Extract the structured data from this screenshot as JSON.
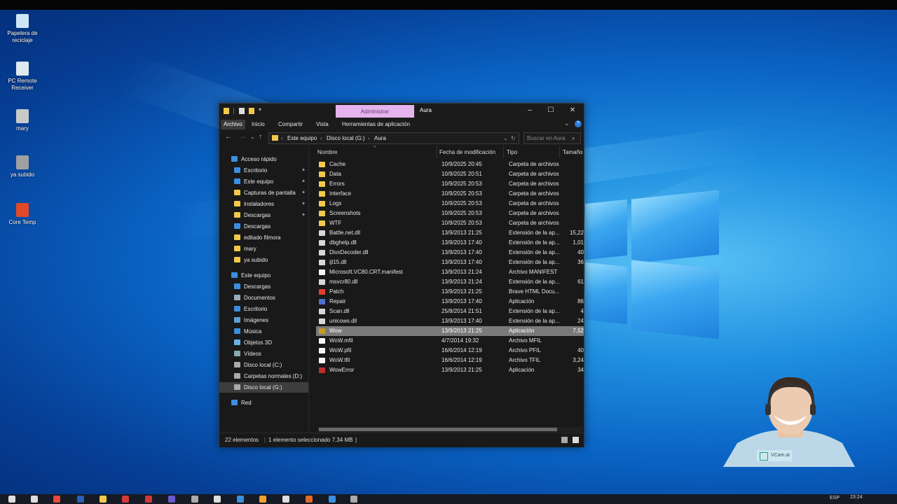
{
  "desktop": {
    "icons": [
      {
        "label": "Papelera de reciclaje",
        "color": "#cfe6f7"
      },
      {
        "label": "PC Remote Receiver",
        "color": "#dfe9f0"
      },
      {
        "label": "mary",
        "color": "#c9c9c9"
      },
      {
        "label": "ya subido",
        "color": "#a0a0a0"
      },
      {
        "label": "Core Temp",
        "color": "#e04a2a"
      }
    ]
  },
  "window": {
    "admin_tab": "Administrar",
    "title": "Aura",
    "minimize": "–",
    "maximize": "☐",
    "close": "✕",
    "help": "?",
    "ribbon_tabs": [
      "Archivo",
      "Inicio",
      "Compartir",
      "Vista",
      "Herramientas de aplicación"
    ],
    "breadcrumb": [
      "Este equipo",
      "Disco local (G:)",
      "Aura"
    ],
    "search_placeholder": "Buscar en Aura"
  },
  "navpane": {
    "quick_access": "Acceso rápido",
    "items": [
      {
        "label": "Acceso rápido",
        "icon": "star-icon",
        "color": "#3b8fe0",
        "pinned": false,
        "indent": 0
      },
      {
        "label": "Escritorio",
        "icon": "desktop-icon",
        "color": "#3b8fe0",
        "pinned": true,
        "indent": 1
      },
      {
        "label": "Este equipo",
        "icon": "computer-icon",
        "color": "#3b8fe0",
        "pinned": true,
        "indent": 1
      },
      {
        "label": "Capturas de pantalla",
        "icon": "folder-icon",
        "color": "#f2c94c",
        "pinned": true,
        "indent": 1
      },
      {
        "label": "instaladores",
        "icon": "folder-icon",
        "color": "#f2c94c",
        "pinned": true,
        "indent": 1
      },
      {
        "label": "Descargas",
        "icon": "folder-icon",
        "color": "#f2c94c",
        "pinned": true,
        "indent": 1
      },
      {
        "label": "Descargas",
        "icon": "download-icon",
        "color": "#3b8fe0",
        "pinned": false,
        "indent": 1
      },
      {
        "label": "editado filmora",
        "icon": "folder-icon",
        "color": "#f2c94c",
        "pinned": false,
        "indent": 1
      },
      {
        "label": "mary",
        "icon": "folder-icon",
        "color": "#f2c94c",
        "pinned": false,
        "indent": 1
      },
      {
        "label": "ya subido",
        "icon": "folder-icon",
        "color": "#f2c94c",
        "pinned": false,
        "indent": 1
      },
      {
        "label": "",
        "icon": "",
        "color": "",
        "pinned": false,
        "indent": 0
      },
      {
        "label": "Este equipo",
        "icon": "computer-icon",
        "color": "#3b8fe0",
        "pinned": false,
        "indent": 0
      },
      {
        "label": "Descargas",
        "icon": "download-icon",
        "color": "#3b8fe0",
        "pinned": false,
        "indent": 1
      },
      {
        "label": "Documentos",
        "icon": "documents-icon",
        "color": "#9ab",
        "pinned": false,
        "indent": 1
      },
      {
        "label": "Escritorio",
        "icon": "desktop-icon",
        "color": "#3b8fe0",
        "pinned": false,
        "indent": 1
      },
      {
        "label": "Imágenes",
        "icon": "images-icon",
        "color": "#5aa0d8",
        "pinned": false,
        "indent": 1
      },
      {
        "label": "Música",
        "icon": "music-icon",
        "color": "#3b8fe0",
        "pinned": false,
        "indent": 1
      },
      {
        "label": "Objetos 3D",
        "icon": "cube-icon",
        "color": "#6ab0e8",
        "pinned": false,
        "indent": 1
      },
      {
        "label": "Vídeos",
        "icon": "video-icon",
        "color": "#8aa",
        "pinned": false,
        "indent": 1
      },
      {
        "label": "Disco local (C:)",
        "icon": "drive-icon",
        "color": "#aaa",
        "pinned": false,
        "indent": 1
      },
      {
        "label": "Carpetas normales (D:)",
        "icon": "drive-icon",
        "color": "#aaa",
        "pinned": false,
        "indent": 1
      },
      {
        "label": "Disco local (G:)",
        "icon": "drive-icon",
        "color": "#aaa",
        "pinned": false,
        "indent": 1,
        "selected": true
      },
      {
        "label": "",
        "icon": "",
        "color": "",
        "pinned": false,
        "indent": 0
      },
      {
        "label": "Red",
        "icon": "network-icon",
        "color": "#3b8fe0",
        "pinned": false,
        "indent": 0
      }
    ]
  },
  "columns": [
    "Nombre",
    "Fecha de modificación",
    "Tipo",
    "Tamaño"
  ],
  "files": [
    {
      "name": "Cache",
      "date": "10/9/2025 20:45",
      "type": "Carpeta de archivos",
      "size": "",
      "icon": "folder-icon",
      "color": "#f2c94c"
    },
    {
      "name": "Data",
      "date": "10/9/2025 20:51",
      "type": "Carpeta de archivos",
      "size": "",
      "icon": "folder-icon",
      "color": "#f2c94c"
    },
    {
      "name": "Errors",
      "date": "10/9/2025 20:53",
      "type": "Carpeta de archivos",
      "size": "",
      "icon": "folder-icon",
      "color": "#f2c94c"
    },
    {
      "name": "Interface",
      "date": "10/9/2025 20:53",
      "type": "Carpeta de archivos",
      "size": "",
      "icon": "folder-icon",
      "color": "#f2c94c"
    },
    {
      "name": "Logs",
      "date": "10/9/2025 20:53",
      "type": "Carpeta de archivos",
      "size": "",
      "icon": "folder-icon",
      "color": "#f2c94c"
    },
    {
      "name": "Screenshots",
      "date": "10/9/2025 20:53",
      "type": "Carpeta de archivos",
      "size": "",
      "icon": "folder-icon",
      "color": "#f2c94c"
    },
    {
      "name": "WTF",
      "date": "10/9/2025 20:53",
      "type": "Carpeta de archivos",
      "size": "",
      "icon": "folder-icon",
      "color": "#f2c94c"
    },
    {
      "name": "Battle.net.dll",
      "date": "13/9/2013 21:25",
      "type": "Extensión de la ap...",
      "size": "15,22",
      "icon": "dll-icon",
      "color": "#d8d8d8"
    },
    {
      "name": "dbghelp.dll",
      "date": "13/9/2013 17:40",
      "type": "Extensión de la ap...",
      "size": "1,01",
      "icon": "dll-icon",
      "color": "#d8d8d8"
    },
    {
      "name": "DivxDecoder.dll",
      "date": "13/9/2013 17:40",
      "type": "Extensión de la ap...",
      "size": "40",
      "icon": "dll-icon",
      "color": "#d8d8d8"
    },
    {
      "name": "ijl15.dll",
      "date": "13/9/2013 17:40",
      "type": "Extensión de la ap...",
      "size": "36",
      "icon": "dll-icon",
      "color": "#d8d8d8"
    },
    {
      "name": "Microsoft.VC80.CRT.manifest",
      "date": "13/9/2013 21:24",
      "type": "Archivo MANIFEST",
      "size": "",
      "icon": "file-icon",
      "color": "#f5f5f5"
    },
    {
      "name": "msvcr80.dll",
      "date": "13/9/2013 21:24",
      "type": "Extensión de la ap...",
      "size": "61",
      "icon": "dll-icon",
      "color": "#d8d8d8"
    },
    {
      "name": "Patch",
      "date": "13/9/2013 21:25",
      "type": "Brave HTML Docu...",
      "size": "",
      "icon": "brave-icon",
      "color": "#e0402a"
    },
    {
      "name": "Repair",
      "date": "13/9/2013 17:40",
      "type": "Aplicación",
      "size": "86",
      "icon": "repair-icon",
      "color": "#4a6fd0"
    },
    {
      "name": "Scan.dll",
      "date": "25/8/2014 21:51",
      "type": "Extensión de la ap...",
      "size": "4",
      "icon": "dll-icon",
      "color": "#d8d8d8"
    },
    {
      "name": "unicows.dll",
      "date": "13/9/2013 17:40",
      "type": "Extensión de la ap...",
      "size": "24",
      "icon": "dll-icon",
      "color": "#d8d8d8"
    },
    {
      "name": "Wow",
      "date": "13/9/2013 21:25",
      "type": "Aplicación",
      "size": "7,52",
      "icon": "wow-icon",
      "color": "#c79b2a",
      "selected": true
    },
    {
      "name": "WoW.mfil",
      "date": "4/7/2014 19:32",
      "type": "Archivo MFIL",
      "size": "",
      "icon": "file-icon",
      "color": "#f5f5f5"
    },
    {
      "name": "WoW.pfil",
      "date": "16/6/2014 12:19",
      "type": "Archivo PFIL",
      "size": "40",
      "icon": "file-icon",
      "color": "#f5f5f5"
    },
    {
      "name": "WoW.tfil",
      "date": "16/6/2014 12:19",
      "type": "Archivo TFIL",
      "size": "3,24",
      "icon": "file-icon",
      "color": "#f5f5f5"
    },
    {
      "name": "WowError",
      "date": "13/9/2013 21:25",
      "type": "Aplicación",
      "size": "34",
      "icon": "wowerror-icon",
      "color": "#c0302a"
    }
  ],
  "status": {
    "count": "22 elementos",
    "selection": "1 elemento seleccionado  7,34 MB"
  },
  "webcam": {
    "badge": "VCam.ai"
  },
  "taskbar": {
    "lang": "ESP",
    "time": "23:24",
    "icons": [
      "windows-icon",
      "search-icon",
      "chrome-icon",
      "word-icon",
      "explorer-icon",
      "app-icon",
      "app-icon",
      "app-icon",
      "app-icon",
      "app-icon",
      "app-icon",
      "app-icon",
      "app-icon",
      "app-icon",
      "app-icon",
      "app-icon"
    ]
  }
}
